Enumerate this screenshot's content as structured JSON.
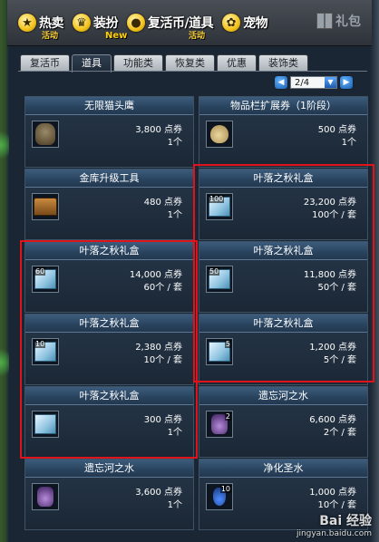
{
  "topnav": [
    {
      "label": "热卖",
      "sub": "活动",
      "icon": "star-icon",
      "glyph": "★"
    },
    {
      "label": "装扮",
      "sub": "New",
      "icon": "trophy-icon",
      "glyph": "♛"
    },
    {
      "label": "复活币/道具",
      "sub": "活动",
      "icon": "coin-icon",
      "glyph": "●"
    },
    {
      "label": "宠物",
      "sub": "",
      "icon": "paw-icon",
      "glyph": "✿"
    }
  ],
  "gift": {
    "label": "礼包",
    "icon": "gift-icon"
  },
  "tabs": [
    "复活币",
    "道具",
    "功能类",
    "恢复类",
    "优惠",
    "装饰类"
  ],
  "active_tab": "道具",
  "pager": {
    "value": "2/4"
  },
  "items": [
    {
      "title": "无限猫头鹰",
      "price": "3,800 点券",
      "qty": "1个",
      "icon": "owl-icon",
      "badge": ""
    },
    {
      "title": "物品栏扩展券（1阶段）",
      "price": "500 点券",
      "qty": "1个",
      "icon": "bag-icon",
      "badge": ""
    },
    {
      "title": "金库升级工具",
      "price": "480 点券",
      "qty": "1个",
      "icon": "chest-icon",
      "badge": ""
    },
    {
      "title": "叶落之秋礼盒",
      "price": "23,200 点券",
      "qty": "100个 / 套",
      "icon": "gift-box-icon",
      "badge": "100"
    },
    {
      "title": "叶落之秋礼盒",
      "price": "14,000 点券",
      "qty": "60个 / 套",
      "icon": "gift-box-icon",
      "badge": "60"
    },
    {
      "title": "叶落之秋礼盒",
      "price": "11,800 点券",
      "qty": "50个 / 套",
      "icon": "gift-box-icon",
      "badge": "50"
    },
    {
      "title": "叶落之秋礼盒",
      "price": "2,380 点券",
      "qty": "10个 / 套",
      "icon": "gift-box-icon",
      "badge": "10"
    },
    {
      "title": "叶落之秋礼盒",
      "price": "1,200 点券",
      "qty": "5个 / 套",
      "icon": "gift-box-icon",
      "badge": "5"
    },
    {
      "title": "叶落之秋礼盒",
      "price": "300 点券",
      "qty": "1个",
      "icon": "gift-box-icon",
      "badge": ""
    },
    {
      "title": "遗忘河之水",
      "price": "6,600 点券",
      "qty": "2个 / 套",
      "icon": "potion-icon",
      "badge": "2"
    },
    {
      "title": "遗忘河之水",
      "price": "3,600 点券",
      "qty": "1个",
      "icon": "potion-icon",
      "badge": ""
    },
    {
      "title": "净化圣水",
      "price": "1,000 点券",
      "qty": "10个 / 套",
      "icon": "holy-water-icon",
      "badge": "10"
    }
  ],
  "watermark": {
    "line1": "Bai 经验",
    "line2": "jingyan.baidu.com"
  }
}
